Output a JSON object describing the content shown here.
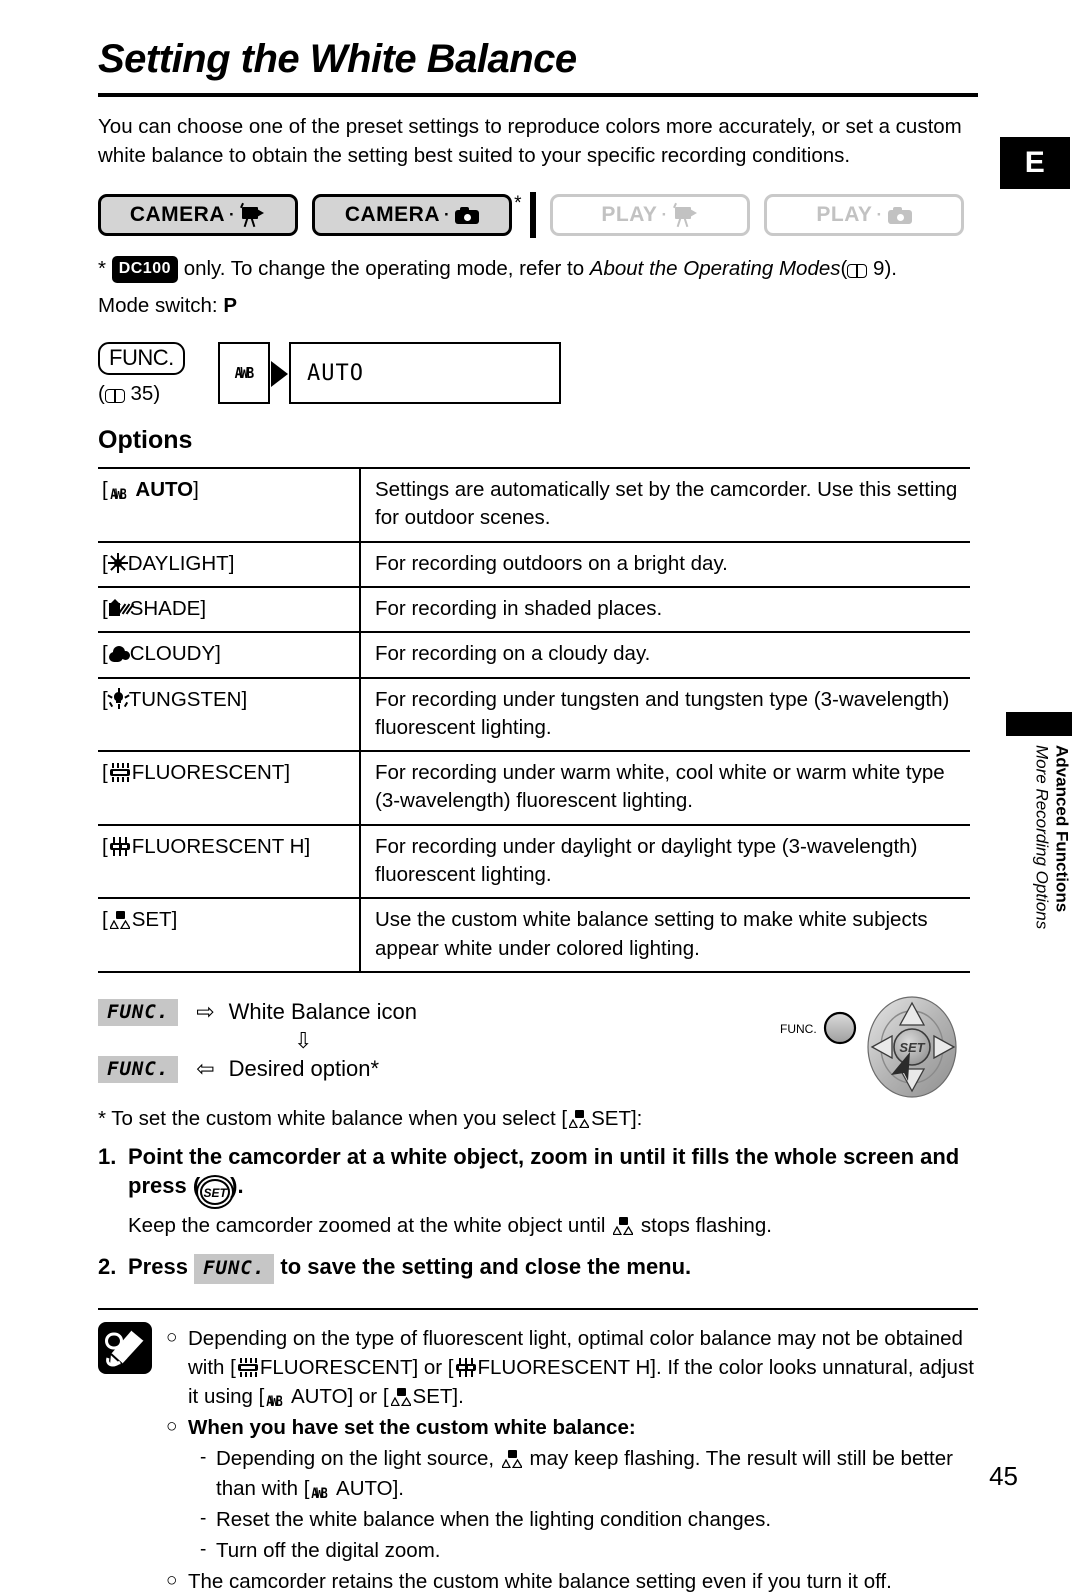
{
  "page": {
    "title": "Setting the White Balance",
    "intro": "You can choose one of the preset settings to reproduce colors more accurately, or set a custom white balance to obtain the setting best suited to your specific recording conditions.",
    "number": "45",
    "edition_tab": "E"
  },
  "side_margin": {
    "chapter": "Advanced Functions",
    "section": "More Recording Options"
  },
  "modes": [
    {
      "label": "CAMERA",
      "icon": "camcorder-icon",
      "active": true,
      "starred": false
    },
    {
      "label": "CAMERA",
      "icon": "still-camera-icon",
      "active": true,
      "starred": true
    },
    {
      "label": "PLAY",
      "icon": "camcorder-icon",
      "active": false,
      "starred": false
    },
    {
      "label": "PLAY",
      "icon": "still-camera-icon",
      "active": false,
      "starred": false
    }
  ],
  "footnote": {
    "star": "*",
    "model_badge": "DC100",
    "text_before": "only. To change the operating mode, refer to ",
    "italic_ref": "About the Operating Modes",
    "open_paren": "(",
    "page_ref": "9",
    "close_paren": ").",
    "mode_switch_label": "Mode switch:",
    "mode_switch_value": "P"
  },
  "flow": {
    "func_label": "FUNC.",
    "page_ref": "35",
    "page_open": "(",
    "page_close": ")",
    "icon_cell": "AWB",
    "value_cell": "AUTO"
  },
  "options_heading": "Options",
  "options_table": {
    "rows": [
      {
        "icon": "awb-icon",
        "key": "AUTO",
        "key_bold": true,
        "desc": "Settings are automatically set by the camcorder. Use this setting for outdoor scenes."
      },
      {
        "icon": "sun-icon",
        "key": "DAYLIGHT",
        "key_bold": false,
        "desc": "For recording outdoors on a bright day."
      },
      {
        "icon": "shade-icon",
        "key": "SHADE",
        "key_bold": false,
        "desc": "For recording in shaded places."
      },
      {
        "icon": "cloud-icon",
        "key": "CLOUDY",
        "key_bold": false,
        "desc": "For recording on a cloudy day."
      },
      {
        "icon": "tungsten-bulb-icon",
        "key": "TUNGSTEN",
        "key_bold": false,
        "desc": "For recording under tungsten and tungsten type (3-wavelength) fluorescent lighting."
      },
      {
        "icon": "fluorescent-icon",
        "key": "FLUORESCENT",
        "key_bold": false,
        "desc": "For recording under warm white, cool white or warm white type (3-wavelength) fluorescent lighting."
      },
      {
        "icon": "fluorescent-h-icon",
        "key": "FLUORESCENT H",
        "key_bold": false,
        "desc": "For recording under daylight or daylight type (3-wavelength) fluorescent lighting."
      },
      {
        "icon": "custom-wb-set-icon",
        "key": "SET",
        "key_bold": false,
        "desc": "Use the custom white balance setting to make white subjects appear white under colored lighting."
      }
    ]
  },
  "sequence": {
    "line1_button": "FUNC.",
    "line1_arrow": "⇨",
    "line1_text": "White Balance icon",
    "middle_arrow": "⇩",
    "line2_button": "FUNC.",
    "line2_arrow": "⇦",
    "line2_text": "Desired option*",
    "joystick_func_label": "FUNC.",
    "joystick_set_label": "SET"
  },
  "steps": {
    "star_note": "* To set the custom white balance when you select [     SET]:",
    "star_note_pre": "* To set the custom white balance when you select [",
    "star_note_post": "SET]:",
    "items": [
      {
        "num": "1.",
        "text_pre": "Point the camcorder at a white object, zoom in until it fills the whole screen and press (",
        "button": "SET",
        "text_post": ").",
        "sub_pre": "Keep the camcorder zoomed at the white object until",
        "sub_post": "stops flashing."
      },
      {
        "num": "2.",
        "text_pre": "Press",
        "button": "FUNC.",
        "text_post": "to save the setting and close the menu."
      }
    ]
  },
  "notes": {
    "icon": "note-pencil-icon",
    "items": [
      {
        "bullet": "○",
        "bold": false,
        "parts_pre": "Depending on the type of fluorescent light, optimal color balance may not be obtained with [",
        "mid1": "FLUORESCENT] or [",
        "mid2": "FLUORESCENT H]. If the color looks unnatural, adjust it using [",
        "mid3": "AUTO] or [",
        "post": "SET]."
      },
      {
        "bullet": "○",
        "bold": true,
        "text": "When you have set the custom white balance:"
      }
    ],
    "sub_items": [
      {
        "bullet": "-",
        "pre": "Depending on the light source,",
        "mid": "may keep flashing. The result will still be better than with [",
        "post": "AUTO]."
      },
      {
        "bullet": "-",
        "text": "Reset the white balance when the lighting condition changes."
      },
      {
        "bullet": "-",
        "text": "Turn off the digital zoom."
      }
    ],
    "last_item": {
      "bullet": "○",
      "text": "The camcorder retains the custom white balance setting even if you turn it off."
    }
  }
}
